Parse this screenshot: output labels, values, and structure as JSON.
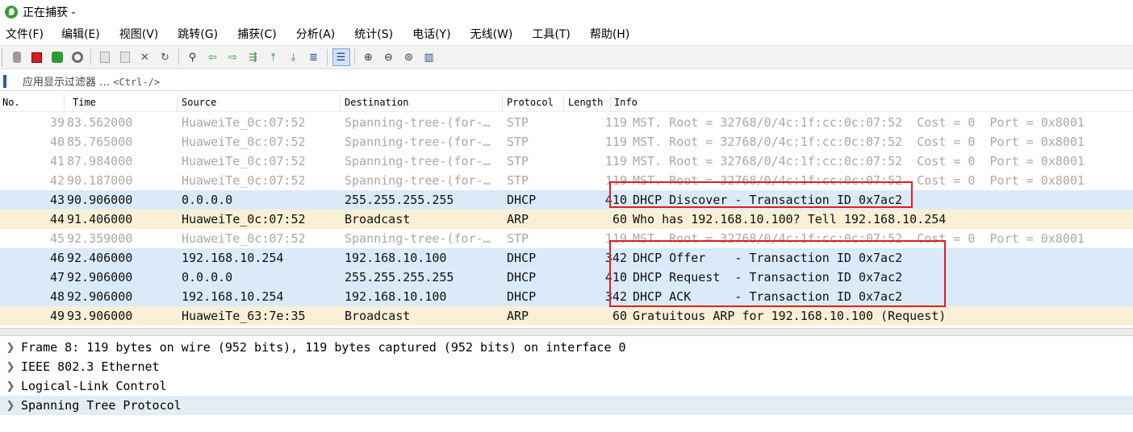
{
  "window": {
    "title": "正在捕获 -"
  },
  "menu": [
    "文件(F)",
    "编辑(E)",
    "视图(V)",
    "跳转(G)",
    "捕获(C)",
    "分析(A)",
    "统计(S)",
    "电话(Y)",
    "无线(W)",
    "工具(T)",
    "帮助(H)"
  ],
  "filter": {
    "label": "应用显示过滤器 …",
    "shortcut": "<Ctrl-/>"
  },
  "columns": [
    "No.",
    "Time",
    "Source",
    "Destination",
    "Protocol",
    "Length",
    "Info"
  ],
  "packets": [
    {
      "no": "39",
      "time": "83.562000",
      "source": "HuaweiTe_0c:07:52",
      "destination": "Spanning-tree-(for-…",
      "protocol": "STP",
      "length": "119",
      "info": "MST. Root = 32768/0/4c:1f:cc:0c:07:52  Cost = 0  Port = 0x8001",
      "kind": "stp"
    },
    {
      "no": "40",
      "time": "85.765000",
      "source": "HuaweiTe_0c:07:52",
      "destination": "Spanning-tree-(for-…",
      "protocol": "STP",
      "length": "119",
      "info": "MST. Root = 32768/0/4c:1f:cc:0c:07:52  Cost = 0  Port = 0x8001",
      "kind": "stp"
    },
    {
      "no": "41",
      "time": "87.984000",
      "source": "HuaweiTe_0c:07:52",
      "destination": "Spanning-tree-(for-…",
      "protocol": "STP",
      "length": "119",
      "info": "MST. Root = 32768/0/4c:1f:cc:0c:07:52  Cost = 0  Port = 0x8001",
      "kind": "stp"
    },
    {
      "no": "42",
      "time": "90.187000",
      "source": "HuaweiTe_0c:07:52",
      "destination": "Spanning-tree-(for-…",
      "protocol": "STP",
      "length": "119",
      "info": "MST. Root = 32768/0/4c:1f:cc:0c:07:52  Cost = 0  Port = 0x8001",
      "kind": "stp"
    },
    {
      "no": "43",
      "time": "90.906000",
      "source": "0.0.0.0",
      "destination": "255.255.255.255",
      "protocol": "DHCP",
      "length": "410",
      "info": "DHCP Discover - Transaction ID 0x7ac2",
      "kind": "dhcp"
    },
    {
      "no": "44",
      "time": "91.406000",
      "source": "HuaweiTe_0c:07:52",
      "destination": "Broadcast",
      "protocol": "ARP",
      "length": "60",
      "info": "Who has 192.168.10.100? Tell 192.168.10.254",
      "kind": "arp"
    },
    {
      "no": "45",
      "time": "92.359000",
      "source": "HuaweiTe_0c:07:52",
      "destination": "Spanning-tree-(for-…",
      "protocol": "STP",
      "length": "119",
      "info": "MST. Root = 32768/0/4c:1f:cc:0c:07:52  Cost = 0  Port = 0x8001",
      "kind": "stp"
    },
    {
      "no": "46",
      "time": "92.406000",
      "source": "192.168.10.254",
      "destination": "192.168.10.100",
      "protocol": "DHCP",
      "length": "342",
      "info": "DHCP Offer    - Transaction ID 0x7ac2",
      "kind": "dhcp"
    },
    {
      "no": "47",
      "time": "92.906000",
      "source": "0.0.0.0",
      "destination": "255.255.255.255",
      "protocol": "DHCP",
      "length": "410",
      "info": "DHCP Request  - Transaction ID 0x7ac2",
      "kind": "dhcp"
    },
    {
      "no": "48",
      "time": "92.906000",
      "source": "192.168.10.254",
      "destination": "192.168.10.100",
      "protocol": "DHCP",
      "length": "342",
      "info": "DHCP ACK      - Transaction ID 0x7ac2",
      "kind": "dhcp"
    },
    {
      "no": "49",
      "time": "93.906000",
      "source": "HuaweiTe_63:7e:35",
      "destination": "Broadcast",
      "protocol": "ARP",
      "length": "60",
      "info": "Gratuitous ARP for 192.168.10.100 (Request)",
      "kind": "arp"
    }
  ],
  "details": [
    {
      "text": "Frame 8: 119 bytes on wire (952 bits), 119 bytes captured (952 bits) on interface 0",
      "selected": false
    },
    {
      "text": "IEEE 802.3 Ethernet",
      "selected": false
    },
    {
      "text": "Logical-Link Control",
      "selected": false
    },
    {
      "text": "Spanning Tree Protocol",
      "selected": true
    }
  ],
  "highlight_color": "#e02020",
  "colors": {
    "dhcp_row": "#dbeaf9",
    "arp_row": "#faf0d7",
    "stp_text": "#a9a9a9"
  }
}
